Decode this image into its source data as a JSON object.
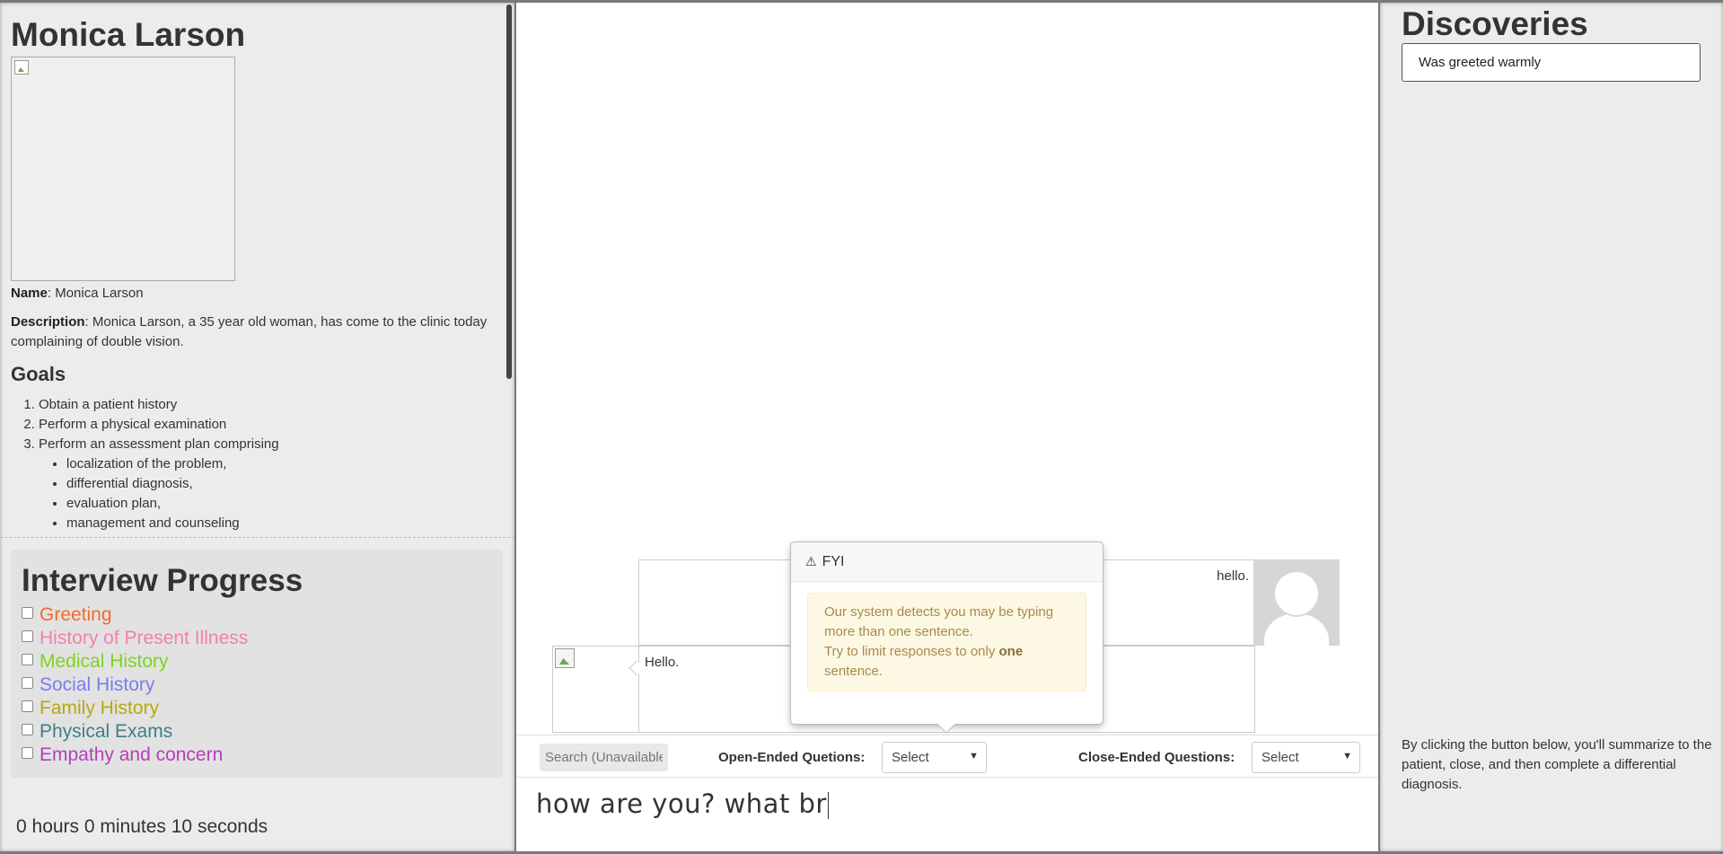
{
  "patient": {
    "name": "Monica Larson",
    "name_label": "Name",
    "name_value": ": Monica Larson",
    "description_label": "Description",
    "description_value": ": Monica Larson, a 35 year old woman, has come to the clinic today complaining of double vision."
  },
  "goals": {
    "title": "Goals",
    "items": [
      "Obtain a patient history",
      "Perform a physical examination",
      "Perform an assessment plan comprising"
    ],
    "sub_items": [
      "localization of the problem,",
      "differential diagnosis,",
      "evaluation plan,",
      "management and counseling"
    ]
  },
  "progress": {
    "title": "Interview Progress",
    "items": [
      {
        "label": "Greeting",
        "color": "#f26a2e"
      },
      {
        "label": "History of Present Illness",
        "color": "#f080b0"
      },
      {
        "label": "Medical History",
        "color": "#7ed321"
      },
      {
        "label": "Social History",
        "color": "#7b7bf0"
      },
      {
        "label": "Family History",
        "color": "#b5a80f"
      },
      {
        "label": "Physical Exams",
        "color": "#3e7f84"
      },
      {
        "label": "Empathy and concern",
        "color": "#b53fb8"
      }
    ]
  },
  "timer": "0 hours 0 minutes 10 seconds",
  "chat": {
    "user_message": "hello.",
    "bot_message": "Hello."
  },
  "fyi": {
    "title": "FYI",
    "line1": "Our system detects you may be typing more than one sentence.",
    "line2_prefix": "Try to limit responses to only ",
    "line2_bold": "one",
    "line2_suffix": " sentence."
  },
  "toolbar": {
    "search_placeholder": "Search (Unavailable)",
    "open_label": "Open-Ended Quetions:",
    "open_select": "Select",
    "close_label": "Close-Ended Questions:",
    "close_select": "Select"
  },
  "entry_text": "how are you? what br",
  "discoveries": {
    "title": "Discoveries",
    "items": [
      "Was greeted warmly"
    ],
    "summary": "By clicking the button below, you'll summarize to the patient, close, and then complete a differential diagnosis."
  }
}
